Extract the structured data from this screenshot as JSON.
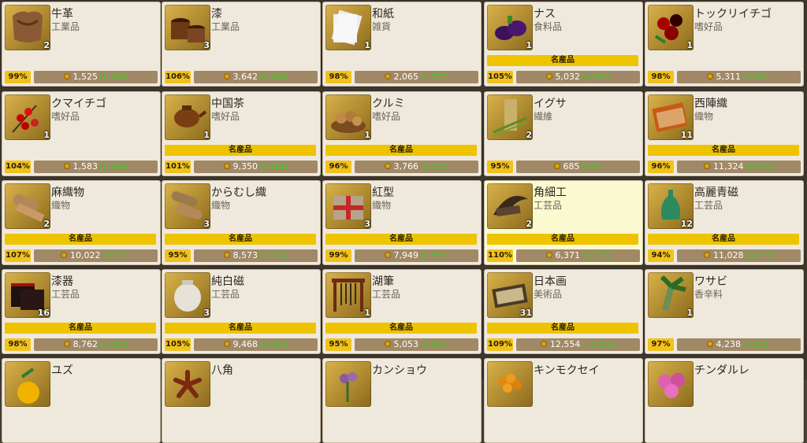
{
  "colors": {
    "special_bar": "#eec400",
    "percent_badge": "#f1c21d",
    "price_box": "#a18967",
    "prev_price": "#42c91e",
    "card_bg": "#efe9dd",
    "card_highlight": "#fbf9cf"
  },
  "icons": {
    "coin": "gold-coin-icon"
  },
  "rows": [
    {
      "items": [
        {
          "name": "牛革",
          "category": "工業品",
          "qty": "2",
          "special": "",
          "percent": "99%",
          "price": "1,525",
          "prev": "(1,159)",
          "icon": "leather-hide-icon",
          "highlight": false
        },
        {
          "name": "漆",
          "category": "工業品",
          "qty": "3",
          "special": "",
          "percent": "106%",
          "price": "3,642",
          "prev": "(3,196)",
          "icon": "lacquer-bucket-icon",
          "highlight": false
        },
        {
          "name": "和紙",
          "category": "雑貨",
          "qty": "1",
          "special": "",
          "percent": "98%",
          "price": "2,065",
          "prev": "(1,757)",
          "icon": "paper-sheet-icon",
          "highlight": false
        },
        {
          "name": "ナス",
          "category": "食料品",
          "qty": "1",
          "special": "名産品",
          "percent": "105%",
          "price": "5,032",
          "prev": "(4,522)",
          "icon": "eggplant-icon",
          "highlight": false
        },
        {
          "name": "トックリイチゴ",
          "category": "嗜好品",
          "qty": "1",
          "special": "",
          "percent": "98%",
          "price": "5,311",
          "prev": "(4,381)",
          "icon": "berry-icon",
          "highlight": false
        }
      ]
    },
    {
      "items": [
        {
          "name": "クマイチゴ",
          "category": "嗜好品",
          "qty": "1",
          "special": "",
          "percent": "104%",
          "price": "1,583",
          "prev": "(1,160)",
          "icon": "red-berry-branch-icon",
          "highlight": false
        },
        {
          "name": "中国茶",
          "category": "嗜好品",
          "qty": "1",
          "special": "名産品",
          "percent": "101%",
          "price": "9,350",
          "prev": "(7,951)",
          "icon": "teapot-icon",
          "highlight": false
        },
        {
          "name": "クルミ",
          "category": "嗜好品",
          "qty": "1",
          "special": "名産品",
          "percent": "96%",
          "price": "3,766",
          "prev": "(3,150)",
          "icon": "walnut-basket-icon",
          "highlight": false
        },
        {
          "name": "イグサ",
          "category": "繊維",
          "qty": "2",
          "special": "",
          "percent": "95%",
          "price": "685",
          "prev": "(371)",
          "icon": "rush-grass-icon",
          "highlight": false
        },
        {
          "name": "西陣織",
          "category": "織物",
          "qty": "11",
          "special": "名産品",
          "percent": "96%",
          "price": "11,324",
          "prev": "(9,970)",
          "icon": "brocade-icon",
          "highlight": false
        }
      ]
    },
    {
      "items": [
        {
          "name": "麻織物",
          "category": "織物",
          "qty": "2",
          "special": "名産品",
          "percent": "107%",
          "price": "10,022",
          "prev": "(8,577)",
          "icon": "cloth-roll-icon",
          "highlight": false
        },
        {
          "name": "からむし織",
          "category": "織物",
          "qty": "3",
          "special": "名産品",
          "percent": "95%",
          "price": "8,573",
          "prev": "(7,527)",
          "icon": "fabric-rolls-icon",
          "highlight": false
        },
        {
          "name": "紅型",
          "category": "織物",
          "qty": "3",
          "special": "名産品",
          "percent": "99%",
          "price": "7,949",
          "prev": "(6,857)",
          "icon": "gift-box-icon",
          "highlight": false
        },
        {
          "name": "角細工",
          "category": "工芸品",
          "qty": "2",
          "special": "名産品",
          "percent": "110%",
          "price": "6,371",
          "prev": "(5,279)",
          "icon": "horn-craft-icon",
          "highlight": true
        },
        {
          "name": "高麗青磁",
          "category": "工芸品",
          "qty": "12",
          "special": "名産品",
          "percent": "94%",
          "price": "11,028",
          "prev": "(9,073)",
          "icon": "celadon-vase-icon",
          "highlight": false
        }
      ]
    },
    {
      "items": [
        {
          "name": "漆器",
          "category": "工芸品",
          "qty": "16",
          "special": "名産品",
          "percent": "98%",
          "price": "8,762",
          "prev": "(7,583)",
          "icon": "lacquerware-box-icon",
          "highlight": false
        },
        {
          "name": "純白磁",
          "category": "工芸品",
          "qty": "3",
          "special": "名産品",
          "percent": "105%",
          "price": "9,468",
          "prev": "(8,094)",
          "icon": "white-jar-icon",
          "highlight": false
        },
        {
          "name": "湖筆",
          "category": "工芸品",
          "qty": "1",
          "special": "名産品",
          "percent": "95%",
          "price": "5,053",
          "prev": "(4,045)",
          "icon": "brush-rack-icon",
          "highlight": false
        },
        {
          "name": "日本画",
          "category": "美術品",
          "qty": "31",
          "special": "名産品",
          "percent": "109%",
          "price": "12,554",
          "prev": "(11,172)",
          "icon": "painting-scroll-icon",
          "highlight": false
        },
        {
          "name": "ワサビ",
          "category": "香辛料",
          "qty": "1",
          "special": "",
          "percent": "97%",
          "price": "4,238",
          "prev": "(3,632)",
          "icon": "wasabi-icon",
          "highlight": false
        }
      ]
    },
    {
      "items": [
        {
          "name": "ユズ",
          "category": "",
          "qty": "",
          "special": "",
          "percent": "",
          "price": "",
          "prev": "",
          "icon": "yuzu-icon",
          "highlight": false
        },
        {
          "name": "八角",
          "category": "",
          "qty": "",
          "special": "",
          "percent": "",
          "price": "",
          "prev": "",
          "icon": "star-anise-icon",
          "highlight": false
        },
        {
          "name": "カンショウ",
          "category": "",
          "qty": "",
          "special": "",
          "percent": "",
          "price": "",
          "prev": "",
          "icon": "flower-plant-icon",
          "highlight": false
        },
        {
          "name": "キンモクセイ",
          "category": "",
          "qty": "",
          "special": "",
          "percent": "",
          "price": "",
          "prev": "",
          "icon": "osmanthus-icon",
          "highlight": false
        },
        {
          "name": "チンダルレ",
          "category": "",
          "qty": "",
          "special": "",
          "percent": "",
          "price": "",
          "prev": "",
          "icon": "azalea-icon",
          "highlight": false
        }
      ]
    }
  ]
}
